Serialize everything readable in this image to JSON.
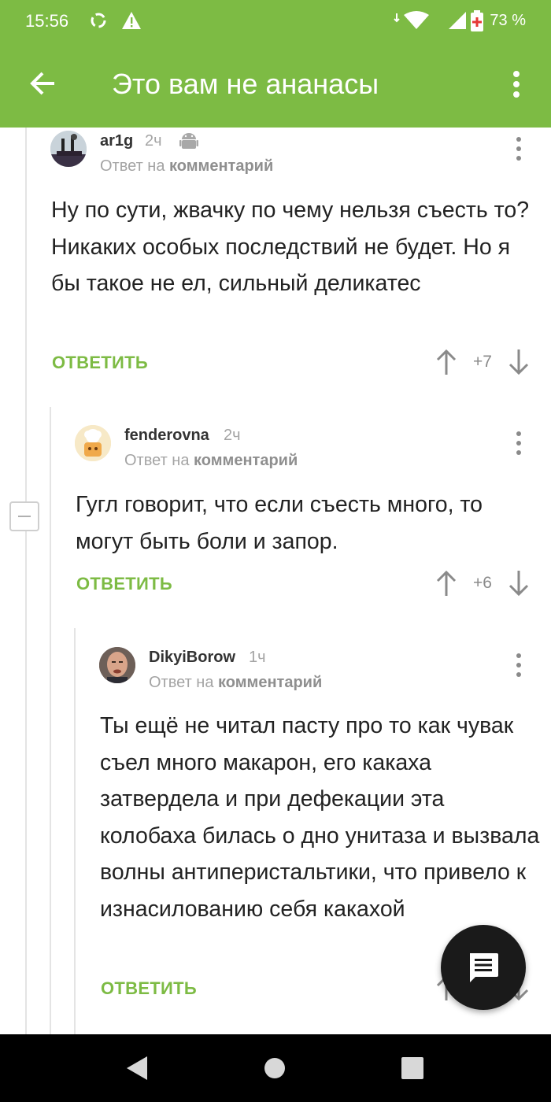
{
  "status": {
    "time": "15:56",
    "battery": "73 %",
    "icons": [
      "sync-icon",
      "warning-icon",
      "wifi-icon",
      "signal-icon",
      "battery-icon"
    ]
  },
  "appbar": {
    "title": "Это вам не ананасы",
    "back_icon": "arrow-back-icon",
    "menu_icon": "more-vert-icon"
  },
  "comments": [
    {
      "author": "ar1g",
      "time": "2ч",
      "platform_icon": "android-icon",
      "reply_prefix": "Ответ на",
      "reply_target": "комментарий",
      "text": "Ну по сути, жвачку по чему нельзя съесть то? Никаких особых последствий не будет. Но я бы такое не ел, сильный деликатес",
      "reply_label": "ОТВЕТИТЬ",
      "score": "+7"
    },
    {
      "author": "fenderovna",
      "time": "2ч",
      "reply_prefix": "Ответ на",
      "reply_target": "комментарий",
      "text": "Гугл говорит, что если съесть много, то могут быть боли и запор.",
      "reply_label": "ОТВЕТИТЬ",
      "score": "+6"
    },
    {
      "author": "DikyiBorow",
      "time": "1ч",
      "reply_prefix": "Ответ на",
      "reply_target": "комментарий",
      "text": "Ты ещё не читал пасту про то как чувак съел много макарон, его какаха затвердела и при дефекации эта колобаха билась о дно унитаза и вызвала волны антиперистальтики, что привело к изнасилованию себя какахой",
      "reply_label": "ОТВЕТИТЬ"
    }
  ],
  "fab_icon": "comment-icon",
  "colors": {
    "accent": "#7dbb44",
    "fab": "#1a1a1a",
    "muted": "#a4a4a4"
  }
}
